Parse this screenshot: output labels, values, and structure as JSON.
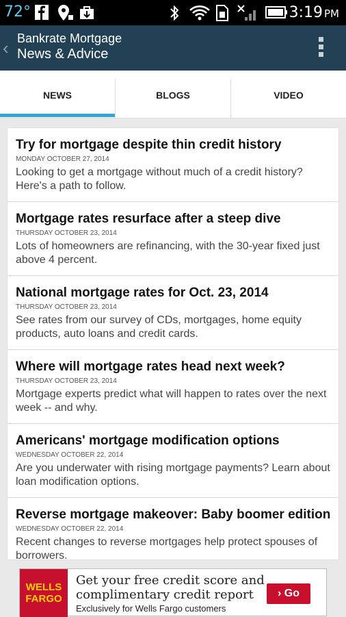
{
  "status_bar": {
    "temperature": "72°",
    "time": "3:19",
    "ampm": "PM",
    "icons": [
      "facebook-icon",
      "location-icon",
      "briefcase-icon",
      "bluetooth-icon",
      "wifi-icon",
      "sim-icon",
      "signal-icon",
      "battery-icon"
    ]
  },
  "app_bar": {
    "title": "Bankrate Mortgage",
    "subtitle": "News & Advice",
    "back_icon": "chevron-left-icon",
    "menu_icon": "overflow-menu-icon"
  },
  "tabs": [
    {
      "label": "NEWS",
      "selected": true
    },
    {
      "label": "BLOGS",
      "selected": false
    },
    {
      "label": "VIDEO",
      "selected": false
    }
  ],
  "colors": {
    "status_bar": "#000000",
    "app_bar": "#234154",
    "tab_indicator": "#33a7d6",
    "background": "#e9e9e9",
    "ad_red": "#c8102e"
  },
  "articles": [
    {
      "title": "Try for mortgage despite thin credit history",
      "date": "MONDAY OCTOBER 27, 2014",
      "summary": "Looking to get a mortgage without much of a credit history? Here's a path to follow."
    },
    {
      "title": "Mortgage rates resurface after a steep dive",
      "date": "THURSDAY OCTOBER 23, 2014",
      "summary": "Lots of homeowners are refinancing, with the 30-year fixed just above 4 percent."
    },
    {
      "title": "National mortgage rates for Oct. 23, 2014",
      "date": "THURSDAY OCTOBER 23, 2014",
      "summary": "See rates from our survey of CDs, mortgages, home equity products, auto loans and credit cards."
    },
    {
      "title": "Where will mortgage rates head next week?",
      "date": "THURSDAY OCTOBER 23, 2014",
      "summary": "Mortgage experts predict what will happen to rates over the next week -- and why."
    },
    {
      "title": "Americans' mortgage modification options",
      "date": "WEDNESDAY OCTOBER 22, 2014",
      "summary": "Are you underwater with rising mortgage payments? Learn about loan modification options."
    },
    {
      "title": "Reverse mortgage makeover: Baby boomer edition",
      "date": "WEDNESDAY OCTOBER 22, 2014",
      "summary": "Recent changes to reverse mortgages help protect spouses of borrowers."
    }
  ],
  "ad": {
    "logo_line1": "WELLS",
    "logo_line2": "FARGO",
    "headline_line1": "Get your free credit score and",
    "headline_line2": "complimentary credit report",
    "subline": "Exclusively for Wells Fargo customers",
    "button_label": "› Go"
  }
}
